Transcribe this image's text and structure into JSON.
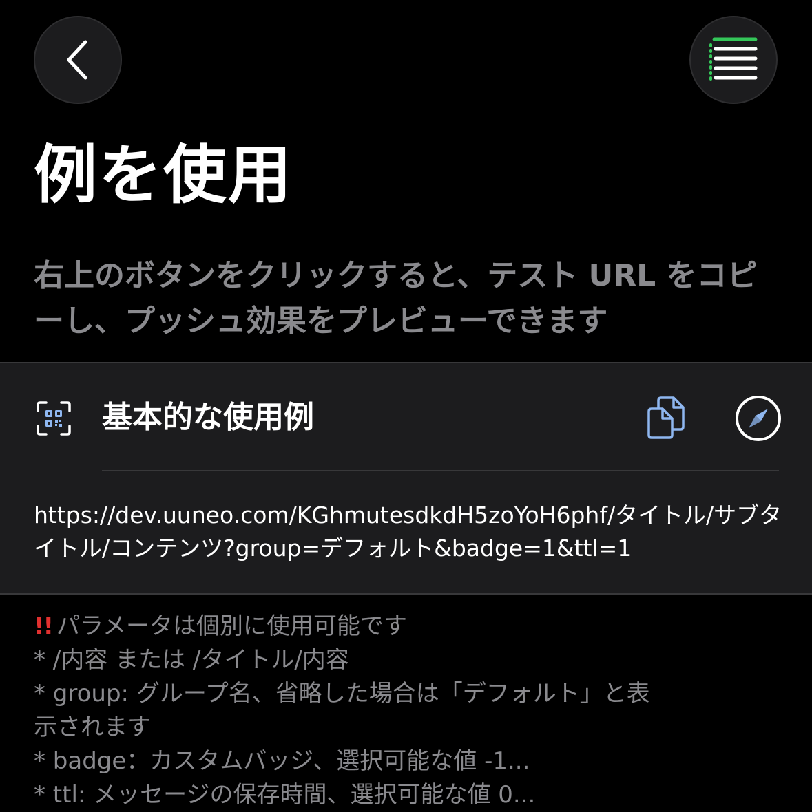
{
  "nav": {
    "back_icon": "chevron-left-icon",
    "menu_icon": "list-icon",
    "menu_accent_color": "#34c759"
  },
  "page": {
    "title": "例を使用",
    "description": "右上のボタンをクリックすると、テスト URL をコピーし、プッシュ効果をプレビューできます"
  },
  "card": {
    "icon": "qr-code-scan-icon",
    "title": "基本的な使用例",
    "copy_icon": "copy-document-icon",
    "open_icon": "safari-compass-icon",
    "icon_accent_color": "#8fb7f0",
    "url": "https://dev.uuneo.com/KGhmutesdkdH5zoYoH6phf/タイトル/サブタイトル/コンテンツ?group=デフォルト&badge=1&ttl=1"
  },
  "notes": {
    "warning_mark": "!!",
    "warning_color": "#e0302f",
    "line1": "パラメータは個別に使用可能です",
    "line2": "* /内容 または /タイトル/内容",
    "line3": "* group: グループ名、省略した場合は「デフォルト」と表示されます",
    "line4": "* badge：カスタムバッジ、選択可能な値 -1...",
    "line5": "* ttl: メッセージの保存時間、選択可能な値 0..."
  }
}
